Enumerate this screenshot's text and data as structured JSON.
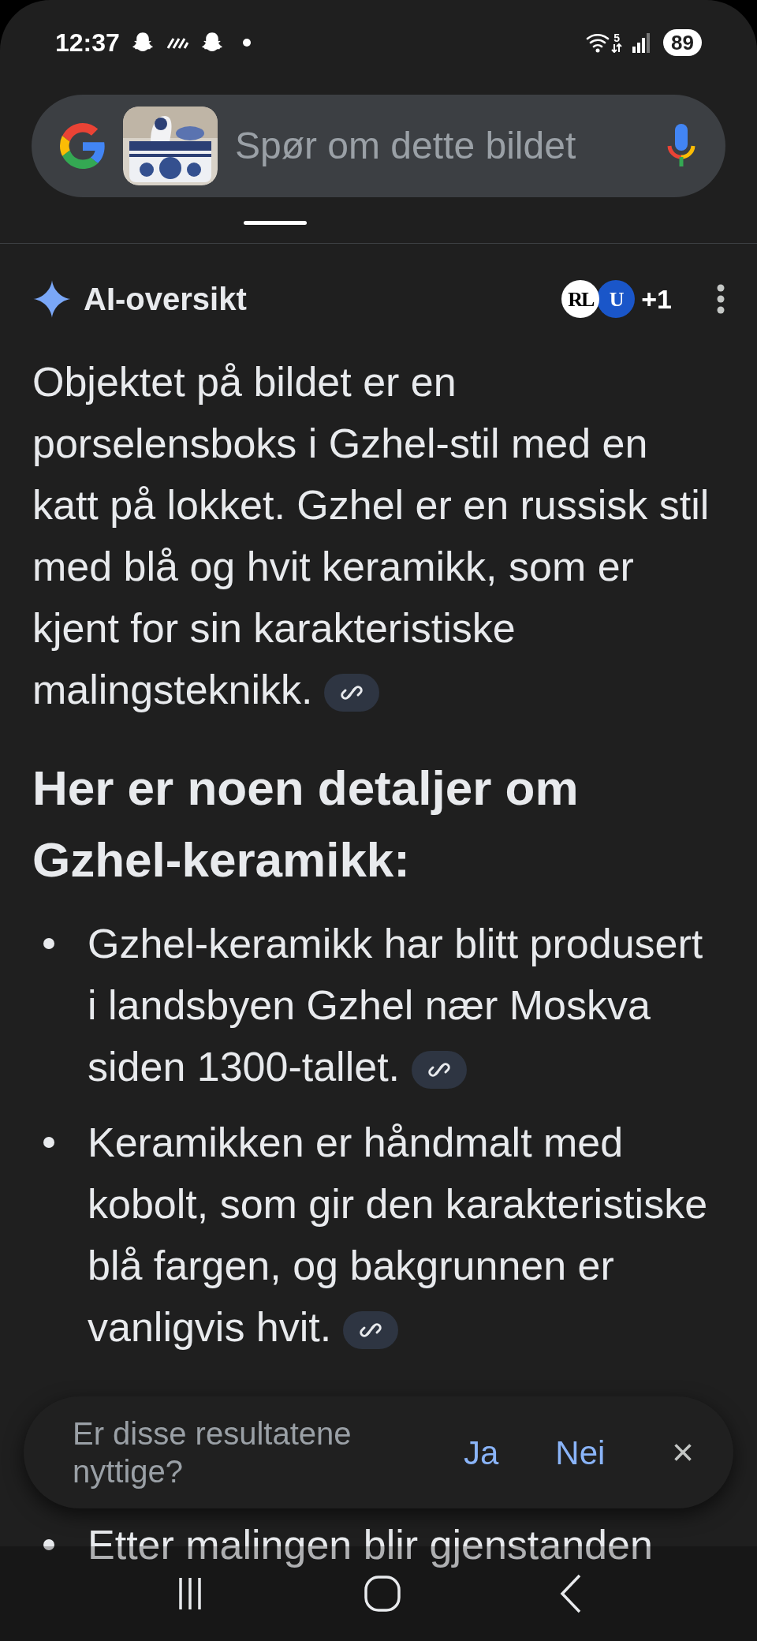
{
  "status_bar": {
    "time": "12:37",
    "network": "5",
    "battery": "89"
  },
  "search": {
    "placeholder": "Spør om dette bildet"
  },
  "ai_overview": {
    "title": "AI-oversikt",
    "sources": [
      {
        "label": "RL"
      },
      {
        "label": "U"
      }
    ],
    "more_sources": "+1",
    "paragraph": {
      "text": "Objektet på bildet er en porselensboks i Gzhel-stil med en katt på lokket. Gzhel er en russisk stil med blå og hvit keramikk, som er kjent for sin karakteristiske malingsteknikk.",
      "has_link": true
    },
    "heading": "Her er noen detaljer om Gzhel-keramikk:",
    "bullets": [
      {
        "text": "Gzhel-keramikk har blitt produsert i landsbyen Gzhel nær Moskva siden 1300-tallet.",
        "has_link": true
      },
      {
        "text": "Keramikken er håndmalt med kobolt, som gir den karakteristiske blå fargen, og bakgrunnen er vanligvis hvit.",
        "has_link": true
      },
      {
        "text": "Etter malingen blir gjenstanden",
        "has_link": false
      }
    ]
  },
  "feedback": {
    "question": "Er disse resultatene nyttige?",
    "yes": "Ja",
    "no": "Nei",
    "close": "×"
  }
}
